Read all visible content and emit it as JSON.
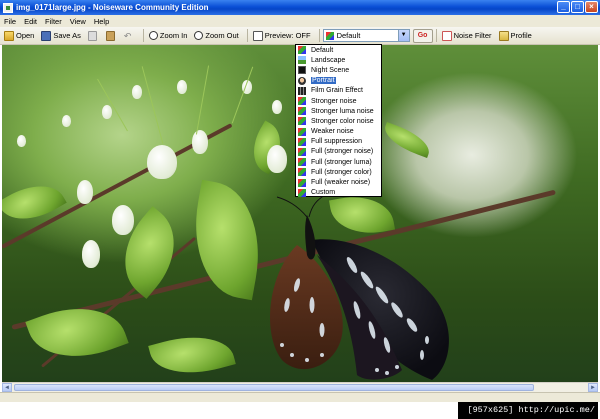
{
  "window": {
    "title": "img_0171large.jpg - Noiseware Community Edition",
    "buttons": {
      "minimize": "_",
      "maximize": "□",
      "close": "×"
    }
  },
  "menu": [
    "File",
    "Edit",
    "Filter",
    "View",
    "Help"
  ],
  "toolbar": {
    "open": "Open",
    "save_as": "Save As",
    "zoom_in": "Zoom In",
    "zoom_out": "Zoom Out",
    "preview": "Preview: OFF",
    "preset_selected": "Default",
    "go": "Go",
    "noise_filter": "Noise Filter",
    "profile": "Profile"
  },
  "dropdown": {
    "selected": "Portrait",
    "items": [
      {
        "label": "Default",
        "icon": "standard-icon"
      },
      {
        "label": "Landscape",
        "icon": "landscape-icon"
      },
      {
        "label": "Night Scene",
        "icon": "night-scene-icon"
      },
      {
        "label": "Portrait",
        "icon": "portrait-icon"
      },
      {
        "label": "Film Grain Effect",
        "icon": "film-icon"
      },
      {
        "label": "Stronger noise",
        "icon": "standard-icon"
      },
      {
        "label": "Stronger luma noise",
        "icon": "standard-icon"
      },
      {
        "label": "Stronger color noise",
        "icon": "standard-icon"
      },
      {
        "label": "Weaker noise",
        "icon": "standard-icon"
      },
      {
        "label": "Full suppression",
        "icon": "standard-icon"
      },
      {
        "label": "Full (stronger noise)",
        "icon": "standard-icon"
      },
      {
        "label": "Full (stronger luma)",
        "icon": "standard-icon"
      },
      {
        "label": "Full (stronger color)",
        "icon": "standard-icon"
      },
      {
        "label": "Full (weaker noise)",
        "icon": "standard-icon"
      },
      {
        "label": "Custom",
        "icon": "standard-icon"
      }
    ]
  },
  "footer": {
    "watermark": "[957x625] http://upic.me/"
  }
}
